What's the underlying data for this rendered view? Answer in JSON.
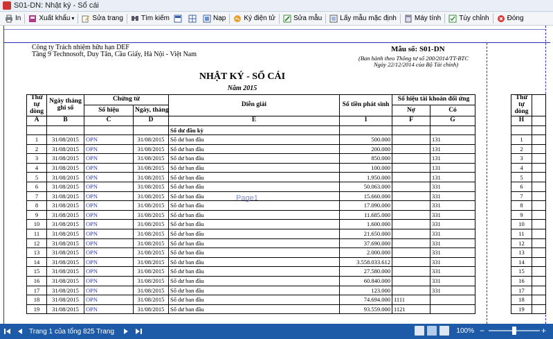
{
  "window": {
    "title": "S01-DN: Nhật ký - Sổ cái"
  },
  "toolbar": [
    {
      "label": "In",
      "icon": "printer-icon"
    },
    {
      "label": "Xuất khẩu",
      "icon": "export-icon",
      "dropdown": true
    },
    {
      "label": "Sửa trang",
      "icon": "edit-page-icon"
    },
    {
      "label": "Tìm kiếm",
      "icon": "search-icon"
    },
    {
      "label": "",
      "icon": "layout-icon"
    },
    {
      "label": "",
      "icon": "grid-icon"
    },
    {
      "label": "Nạp",
      "icon": "load-icon"
    },
    {
      "label": "Ký điện tử",
      "icon": "signature-icon"
    },
    {
      "label": "Sửa mẫu",
      "icon": "edit-template-icon"
    },
    {
      "label": "Lấy mẫu mặc định",
      "icon": "default-template-icon"
    },
    {
      "label": "Máy tính",
      "icon": "calculator-icon"
    },
    {
      "label": "Tùy chỉnh",
      "icon": "customize-icon"
    },
    {
      "label": "Đóng",
      "icon": "close-icon"
    }
  ],
  "report": {
    "company": "Công ty Trách nhiệm hữu hạn DEF",
    "address": "Tầng 9 Technosoft, Duy Tân, Cầu Giấy, Hà Nội - Việt Nam",
    "form_no": "Mẫu số: S01-DN",
    "issued_by": "(Ban hành theo Thông tư số 200/2014/TT-BTC",
    "issued_date": "Ngày 22/12/2014 của Bộ Tài chính)",
    "title": "NHẬT KÝ - SỔ CÁI",
    "year": "Năm 2015",
    "watermark": "Page1"
  },
  "table": {
    "headers": {
      "stt": "Thứ tự dòng",
      "ngay": "Ngày tháng ghi sổ",
      "chung_tu": "Chứng từ",
      "so_hieu": "Số hiệu",
      "ngay_thang": "Ngày, tháng",
      "dien_giai": "Diễn giải",
      "so_tien": "Số tiền phát sinh",
      "tk_doi_ung": "Số hiệu tài khoản đối ứng",
      "no": "Nợ",
      "co": "Có"
    },
    "codes": [
      "A",
      "B",
      "C",
      "D",
      "E",
      "1",
      "F",
      "G"
    ],
    "opening_label": "Số dư đầu kỳ",
    "rows": [
      {
        "stt": "1",
        "ngay": "31/08/2015",
        "so": "OPN",
        "ngay_ct": "31/08/2015",
        "dg": "Số dư ban đầu",
        "tien": "500.000",
        "no": "",
        "co": "131"
      },
      {
        "stt": "2",
        "ngay": "31/08/2015",
        "so": "OPN",
        "ngay_ct": "31/08/2015",
        "dg": "Số dư ban đầu",
        "tien": "200.000",
        "no": "",
        "co": "131"
      },
      {
        "stt": "3",
        "ngay": "31/08/2015",
        "so": "OPN",
        "ngay_ct": "31/08/2015",
        "dg": "Số dư ban đầu",
        "tien": "850.000",
        "no": "",
        "co": "131"
      },
      {
        "stt": "4",
        "ngay": "31/08/2015",
        "so": "OPN",
        "ngay_ct": "31/08/2015",
        "dg": "Số dư ban đầu",
        "tien": "100.000",
        "no": "",
        "co": "131"
      },
      {
        "stt": "5",
        "ngay": "31/08/2015",
        "so": "OPN",
        "ngay_ct": "31/08/2015",
        "dg": "Số dư ban đầu",
        "tien": "1.950.000",
        "no": "",
        "co": "131"
      },
      {
        "stt": "6",
        "ngay": "31/08/2015",
        "so": "OPN",
        "ngay_ct": "31/08/2015",
        "dg": "Số dư ban đầu",
        "tien": "50.063.000",
        "no": "",
        "co": "331"
      },
      {
        "stt": "7",
        "ngay": "31/08/2015",
        "so": "OPN",
        "ngay_ct": "31/08/2015",
        "dg": "Số dư ban đầu",
        "tien": "15.660.000",
        "no": "",
        "co": "331"
      },
      {
        "stt": "8",
        "ngay": "31/08/2015",
        "so": "OPN",
        "ngay_ct": "31/08/2015",
        "dg": "Số dư ban đầu",
        "tien": "17.090.000",
        "no": "",
        "co": "331"
      },
      {
        "stt": "9",
        "ngay": "31/08/2015",
        "so": "OPN",
        "ngay_ct": "31/08/2015",
        "dg": "Số dư ban đầu",
        "tien": "11.685.000",
        "no": "",
        "co": "331"
      },
      {
        "stt": "10",
        "ngay": "31/08/2015",
        "so": "OPN",
        "ngay_ct": "31/08/2015",
        "dg": "Số dư ban đầu",
        "tien": "1.600.000",
        "no": "",
        "co": "331"
      },
      {
        "stt": "11",
        "ngay": "31/08/2015",
        "so": "OPN",
        "ngay_ct": "31/08/2015",
        "dg": "Số dư ban đầu",
        "tien": "21.650.000",
        "no": "",
        "co": "331"
      },
      {
        "stt": "12",
        "ngay": "31/08/2015",
        "so": "OPN",
        "ngay_ct": "31/08/2015",
        "dg": "Số dư ban đầu",
        "tien": "37.690.000",
        "no": "",
        "co": "331"
      },
      {
        "stt": "13",
        "ngay": "31/08/2015",
        "so": "OPN",
        "ngay_ct": "31/08/2015",
        "dg": "Số dư ban đầu",
        "tien": "2.000.000",
        "no": "",
        "co": "331"
      },
      {
        "stt": "14",
        "ngay": "31/08/2015",
        "so": "OPN",
        "ngay_ct": "31/08/2015",
        "dg": "Số dư ban đầu",
        "tien": "3.558.033.612",
        "no": "",
        "co": "331"
      },
      {
        "stt": "15",
        "ngay": "31/08/2015",
        "so": "OPN",
        "ngay_ct": "31/08/2015",
        "dg": "Số dư ban đầu",
        "tien": "27.580.000",
        "no": "",
        "co": "331"
      },
      {
        "stt": "16",
        "ngay": "31/08/2015",
        "so": "OPN",
        "ngay_ct": "31/08/2015",
        "dg": "Số dư ban đầu",
        "tien": "60.840.000",
        "no": "",
        "co": "331"
      },
      {
        "stt": "17",
        "ngay": "31/08/2015",
        "so": "OPN",
        "ngay_ct": "31/08/2015",
        "dg": "Số dư ban đầu",
        "tien": "123.000",
        "no": "",
        "co": "331"
      },
      {
        "stt": "18",
        "ngay": "31/08/2015",
        "so": "OPN",
        "ngay_ct": "31/08/2015",
        "dg": "Số dư ban đầu",
        "tien": "74.694.000",
        "no": "1111",
        "co": ""
      },
      {
        "stt": "19",
        "ngay": "31/08/2015",
        "so": "OPN",
        "ngay_ct": "31/08/2015",
        "dg": "Số dư ban đầu",
        "tien": "93.559.000",
        "no": "1121",
        "co": ""
      }
    ],
    "right_page": {
      "header": "Thứ tự dòng",
      "code": "H"
    }
  },
  "status": {
    "page_info": "Trang 1 của tổng 825 Trang",
    "zoom": "100%"
  },
  "colors": {
    "accent": "#1d5aa8",
    "page_border": "#2b2fb8",
    "link": "#1f2fd0"
  }
}
